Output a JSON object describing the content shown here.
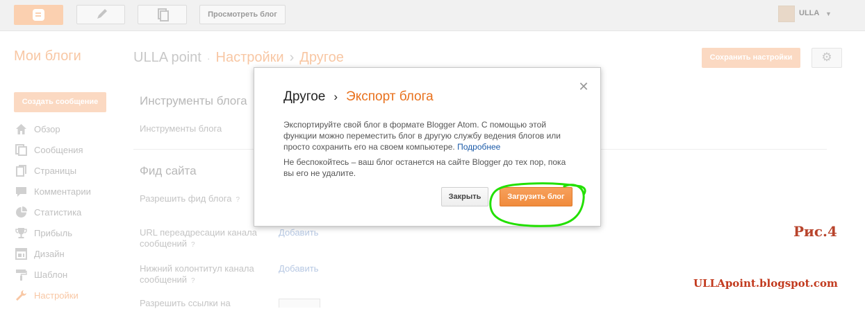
{
  "topbar": {
    "view_blog": "Просмотреть блог",
    "user_name": "ULLA"
  },
  "header": {
    "my_blogs": "Мои блоги",
    "blog_name": "ULLA point",
    "crumb_settings": "Настройки",
    "crumb_other": "Другое",
    "save_settings": "Сохранить настройки"
  },
  "sidebar": {
    "create_post": "Создать сообщение",
    "items": [
      {
        "label": "Обзор",
        "icon": "home-icon"
      },
      {
        "label": "Сообщения",
        "icon": "posts-icon"
      },
      {
        "label": "Страницы",
        "icon": "pages-icon"
      },
      {
        "label": "Комментарии",
        "icon": "comments-icon"
      },
      {
        "label": "Статистика",
        "icon": "stats-icon"
      },
      {
        "label": "Прибыль",
        "icon": "trophy-icon"
      },
      {
        "label": "Дизайн",
        "icon": "layout-icon"
      },
      {
        "label": "Шаблон",
        "icon": "paint-roller-icon"
      },
      {
        "label": "Настройки",
        "icon": "wrench-icon"
      }
    ]
  },
  "main": {
    "tools_title": "Инструменты блога",
    "tools_label": "Инструменты блога",
    "feed_title": "Фид сайта",
    "allow_feed": "Разрешить фид блога",
    "redirect_url_1": "URL переадресации канала",
    "redirect_url_2": "сообщений",
    "footer_1": "Нижний колонтитул канала",
    "footer_2": "сообщений",
    "enable_links_partial": "Разрешить ссылки на",
    "add_link": "Добавить",
    "help_mark": "?"
  },
  "modal": {
    "title_main": "Другое",
    "title_sep": "›",
    "title_sub": "Экспорт блога",
    "paragraph1": "Экспортируйте свой блог в формате Blogger Atom. С помощью этой функции можно переместить блог в другую службу ведения блогов или просто сохранить его на своем компьютере.",
    "more_link": "Подробнее",
    "paragraph2": "Не беспокойтесь – ваш блог останется на сайте Blogger до тех пор, пока вы его не удалите.",
    "close_button": "Закрыть",
    "download_button": "Загрузить блог"
  },
  "watermark": {
    "figure": "Рис.4",
    "site": "ULLApoint.blogspot.com"
  },
  "colors": {
    "accent_orange": "#f08b3c",
    "title_orange": "#e8711d",
    "link_blue": "#1a5aa8",
    "annotation_green": "#22e000",
    "watermark_red": "#c23b1f"
  }
}
